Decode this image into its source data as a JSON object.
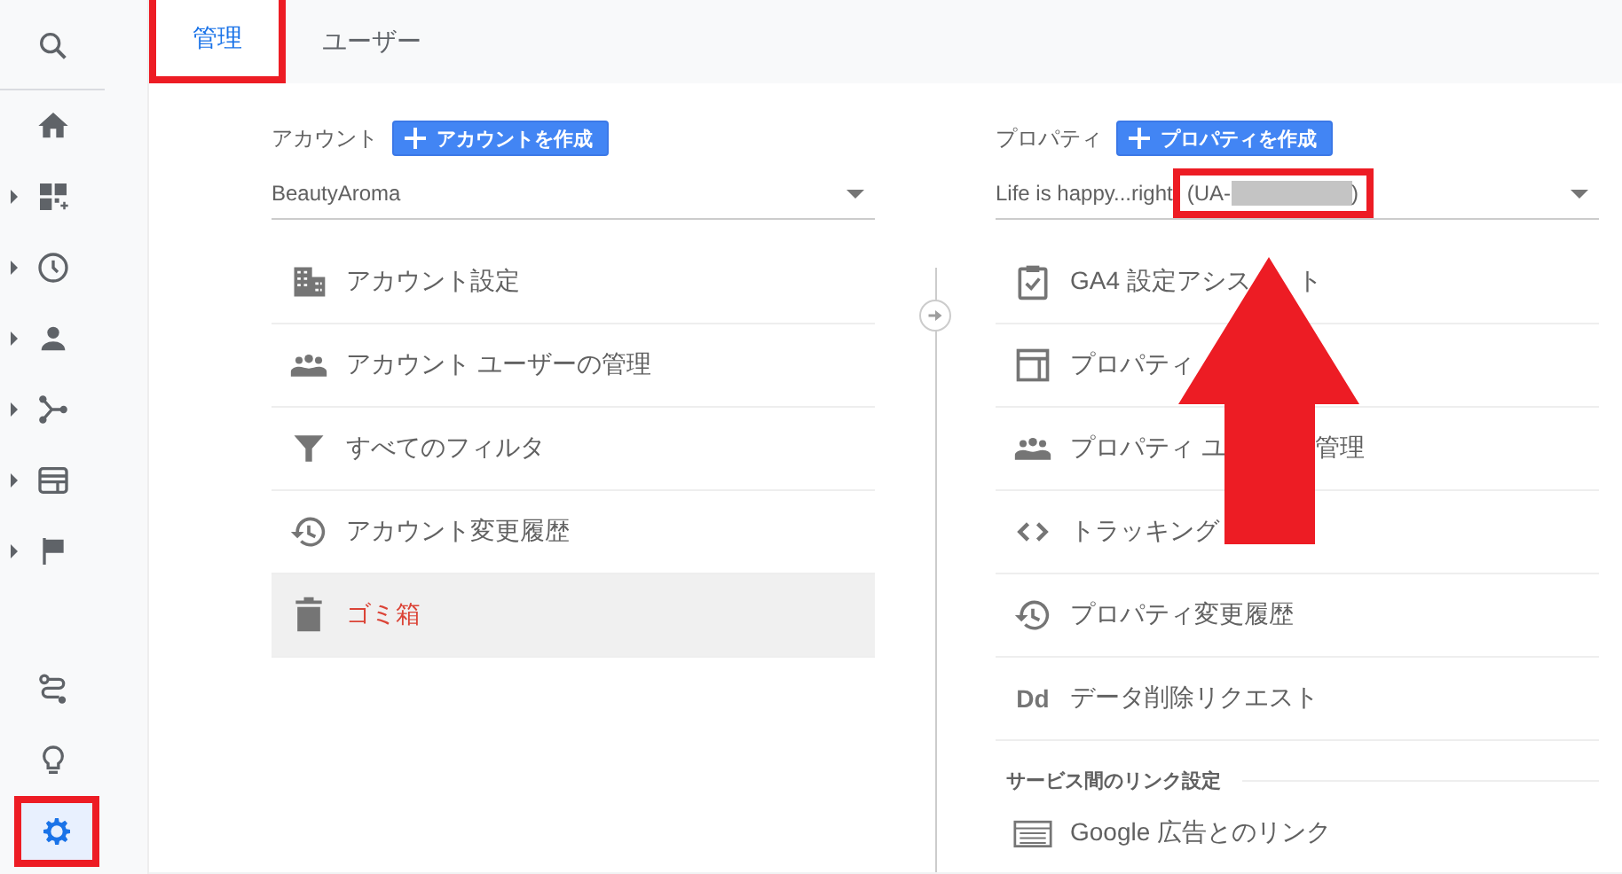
{
  "sidebar": {
    "top": [
      {
        "expandable": false,
        "selected": false,
        "annotated": false
      }
    ],
    "main": [
      {
        "expandable": false,
        "selected": false,
        "annotated": false
      },
      {
        "expandable": true,
        "selected": false,
        "annotated": false
      },
      {
        "expandable": true,
        "selected": false,
        "annotated": false
      },
      {
        "expandable": true,
        "selected": false,
        "annotated": false
      },
      {
        "expandable": true,
        "selected": false,
        "annotated": false
      },
      {
        "expandable": true,
        "selected": false,
        "annotated": false
      },
      {
        "expandable": true,
        "selected": false,
        "annotated": false
      }
    ],
    "bottom": [
      {
        "expandable": false,
        "selected": false,
        "annotated": false
      },
      {
        "expandable": false,
        "selected": false,
        "annotated": false
      },
      {
        "expandable": false,
        "selected": true,
        "annotated": true
      }
    ]
  },
  "tabs": [
    {
      "label": "管理",
      "selected": true,
      "annotated": true
    },
    {
      "label": "ユーザー",
      "selected": false,
      "annotated": false
    }
  ],
  "account": {
    "label": "アカウント",
    "create_button": "アカウントを作成",
    "value": "BeautyAroma",
    "items": [
      {
        "parts": [
          "アカウント設定"
        ],
        "selected": false,
        "danger": false
      },
      {
        "parts": [
          "アカウント ユーザーの管理"
        ],
        "selected": false,
        "danger": false
      },
      {
        "parts": [
          "すべてのフィルタ"
        ],
        "selected": false,
        "danger": false
      },
      {
        "parts": [
          "アカウント変更履歴"
        ],
        "selected": false,
        "danger": false
      },
      {
        "parts": [
          "ゴミ箱"
        ],
        "selected": true,
        "danger": true
      }
    ]
  },
  "property": {
    "label": "プロパティ",
    "create_button": "プロパティを作成",
    "value": "Life is happy...right",
    "id_prefix": "(UA-",
    "id_redacted": true,
    "id_suffix": ")",
    "id_annotated": true,
    "items": [
      {
        "parts": [
          "GA4 設定アシス",
          "ト"
        ],
        "selected": false,
        "danger": false
      },
      {
        "parts": [
          "プロパティ"
        ],
        "selected": false,
        "danger": false
      },
      {
        "parts": [
          "プロパティ ユ",
          "管理"
        ],
        "selected": false,
        "danger": false
      },
      {
        "parts": [
          "トラッキング"
        ],
        "selected": false,
        "danger": false
      },
      {
        "parts": [
          "プロパティ変更履歴"
        ],
        "selected": false,
        "danger": false
      },
      {
        "icon_text": "Dd",
        "parts": [
          "データ削除リクエスト"
        ],
        "selected": false,
        "danger": false
      }
    ],
    "section": {
      "title": "サービス間のリンク設定",
      "items": [
        {
          "parts": [
            "Google 広告とのリンク"
          ],
          "selected": false,
          "danger": false
        }
      ]
    }
  },
  "annotations": [
    {
      "kind": "arrow"
    }
  ]
}
